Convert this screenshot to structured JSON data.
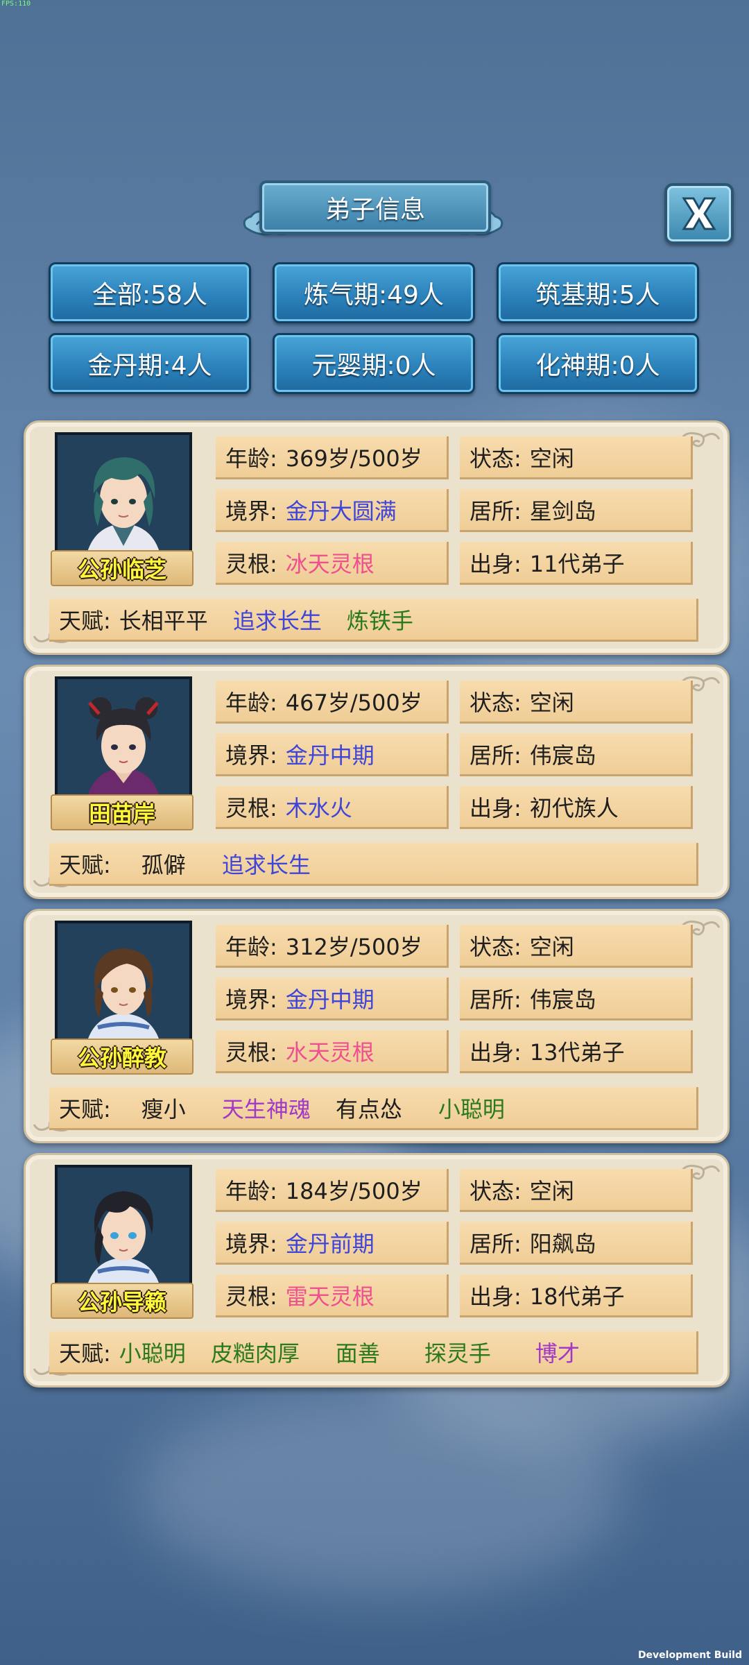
{
  "debug": {
    "fps": "FPS:110",
    "build": "Development Build"
  },
  "header": {
    "title": "弟子信息",
    "close_label": "X"
  },
  "filters": [
    {
      "label": "全部:58人"
    },
    {
      "label": "炼气期:49人"
    },
    {
      "label": "筑基期:5人"
    },
    {
      "label": "金丹期:4人"
    },
    {
      "label": "元婴期:0人"
    },
    {
      "label": "化神期:0人"
    }
  ],
  "field_labels": {
    "age": "年龄:",
    "status": "状态:",
    "realm": "境界:",
    "residence": "居所:",
    "root": "灵根:",
    "origin": "出身:",
    "talent": "天赋:"
  },
  "disciples": [
    {
      "name": "公孙临芝",
      "age": "369岁/500岁",
      "status": "空闲",
      "realm": "金丹大圆满",
      "residence": "星剑岛",
      "root": "冰天灵根",
      "origin": "11代弟子",
      "talents": [
        {
          "text": "长相平平",
          "color": "#1e1e1e"
        },
        {
          "text": "追求长生",
          "color": "#3f45d8"
        },
        {
          "text": "炼铁手",
          "color": "#2a7a1c"
        }
      ]
    },
    {
      "name": "田苗岸",
      "age": "467岁/500岁",
      "status": "空闲",
      "realm": "金丹中期",
      "residence": "伟宸岛",
      "root": "木水火",
      "origin": "初代族人",
      "talents": [
        {
          "text": "孤僻",
          "color": "#1e1e1e"
        },
        {
          "text": "追求长生",
          "color": "#3f45d8"
        }
      ]
    },
    {
      "name": "公孙醉教",
      "age": "312岁/500岁",
      "status": "空闲",
      "realm": "金丹中期",
      "residence": "伟宸岛",
      "root": "水天灵根",
      "origin": "13代弟子",
      "talents": [
        {
          "text": "瘦小",
          "color": "#1e1e1e"
        },
        {
          "text": "天生神魂",
          "color": "#a238c6"
        },
        {
          "text": "有点怂",
          "color": "#1e1e1e"
        },
        {
          "text": "小聪明",
          "color": "#2a7a1c"
        }
      ]
    },
    {
      "name": "公孙导籁",
      "age": "184岁/500岁",
      "status": "空闲",
      "realm": "金丹前期",
      "residence": "阳飙岛",
      "root": "雷天灵根",
      "origin": "18代弟子",
      "talents": [
        {
          "text": "小聪明",
          "color": "#2a7a1c"
        },
        {
          "text": "皮糙肉厚",
          "color": "#2a7a1c"
        },
        {
          "text": "面善",
          "color": "#2a7a1c"
        },
        {
          "text": "探灵手",
          "color": "#2a7a1c"
        },
        {
          "text": "博才",
          "color": "#a238c6"
        }
      ]
    }
  ],
  "colors": {
    "realm_text": "#3f45d8",
    "root_pink": "#ee4f8f",
    "root_blue": "#3f45d8"
  }
}
